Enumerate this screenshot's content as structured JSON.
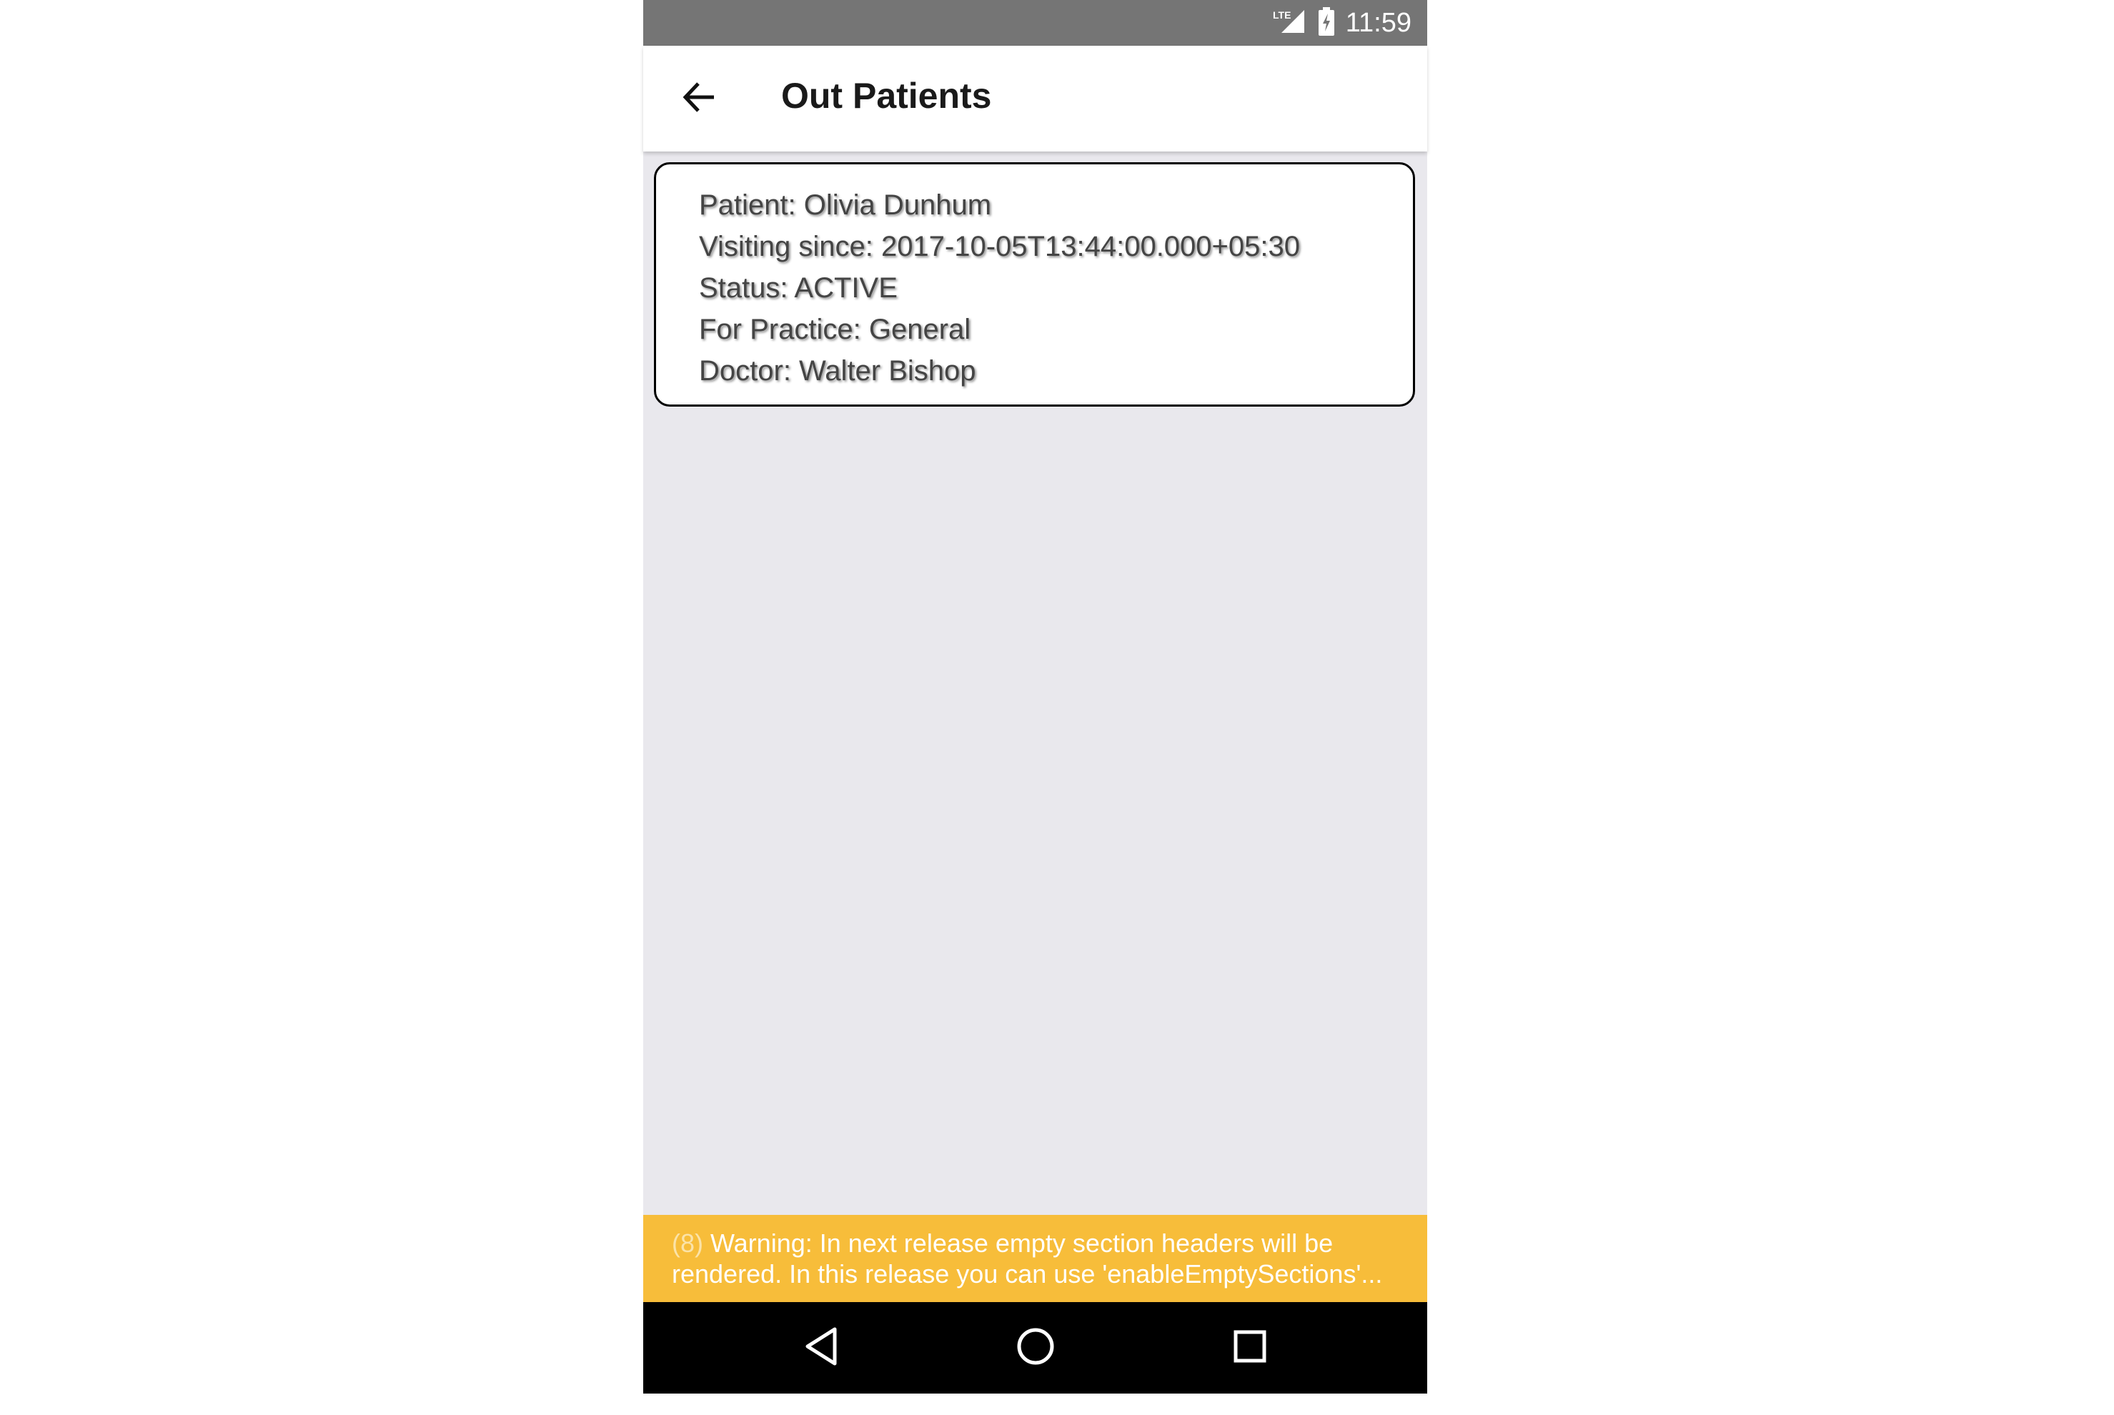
{
  "status_bar": {
    "network": "LTE",
    "time": "11:59",
    "icons": [
      "lte-signal-icon",
      "battery-charging-icon"
    ]
  },
  "app_bar": {
    "back_icon": "arrow-left-icon",
    "title": "Out Patients"
  },
  "patients": [
    {
      "patient": "Patient: Olivia Dunhum",
      "visiting_since": "Visiting since: 2017-10-05T13:44:00.000+05:30",
      "status": "Status: ACTIVE",
      "practice": "For Practice: General",
      "doctor": "Doctor: Walter Bishop"
    }
  ],
  "warning": {
    "count": "(8)",
    "message": "Warning: In next release empty section headers will be rendered. In this release you can use 'enableEmptySections'..."
  },
  "colors": {
    "status_bar": "#757575",
    "content_background": "#e9e8ed",
    "warning_background": "#f7bd3a",
    "nav_bar": "#000000"
  },
  "nav_bar": {
    "icons": [
      "back-triangle-icon",
      "home-circle-icon",
      "recents-square-icon"
    ]
  }
}
